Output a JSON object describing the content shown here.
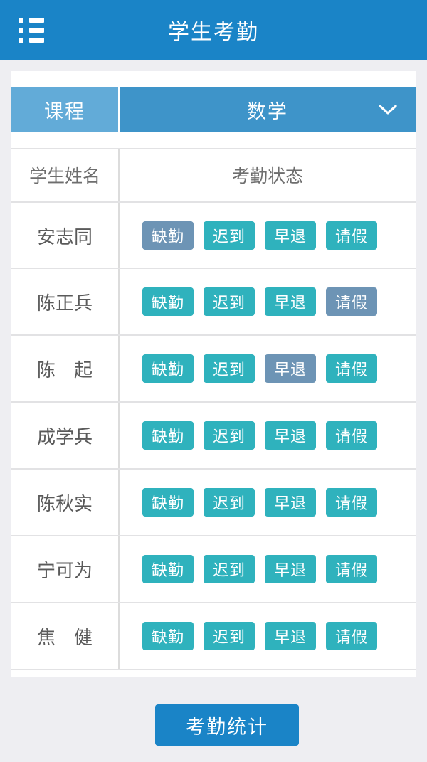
{
  "appbar": {
    "title": "学生考勤",
    "menu_icon": "list-menu-icon"
  },
  "selector": {
    "label": "课程",
    "value": "数学",
    "chevron_icon": "chevron-down-icon"
  },
  "table": {
    "headers": {
      "name": "学生姓名",
      "status": "考勤状态"
    },
    "status_options": [
      "缺勤",
      "迟到",
      "早退",
      "请假"
    ],
    "rows": [
      {
        "name": "安志同",
        "selected": "缺勤"
      },
      {
        "name": "陈正兵",
        "selected": "请假"
      },
      {
        "name": "陈　起",
        "selected": "早退"
      },
      {
        "name": "成学兵",
        "selected": ""
      },
      {
        "name": "陈秋实",
        "selected": ""
      },
      {
        "name": "宁可为",
        "selected": ""
      },
      {
        "name": "焦　健",
        "selected": ""
      }
    ]
  },
  "footer": {
    "stats_button": "考勤统计"
  },
  "colors": {
    "appbar_blue": "#1a84c7",
    "selector_label_blue": "#62abd8",
    "selector_value_blue": "#3e94c9",
    "badge_teal": "#2fb2bd",
    "badge_selected_slate": "#6d94b5",
    "page_background": "#eeeef2",
    "text_gray": "#5a5a5a"
  }
}
